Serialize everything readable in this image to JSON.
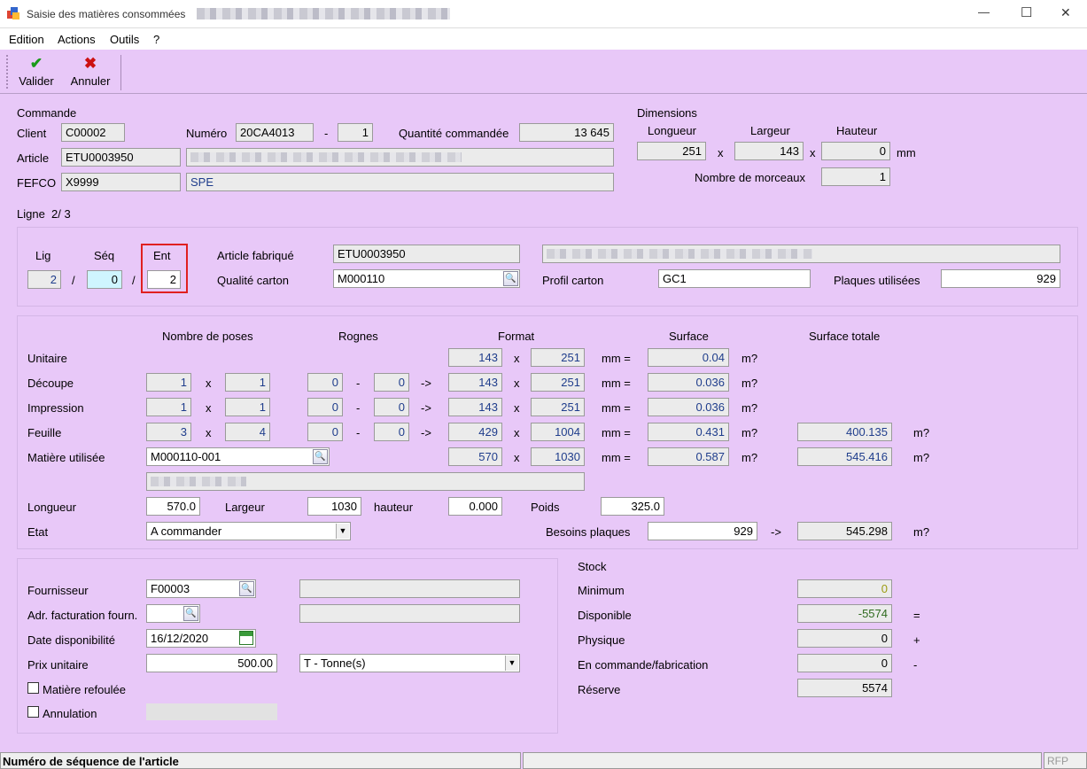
{
  "window": {
    "title": "Saisie des matières consommées",
    "minimize": "—",
    "maximize": "☐",
    "close": "✕"
  },
  "menu": [
    "Edition",
    "Actions",
    "Outils",
    "?"
  ],
  "toolbar": {
    "validate": "Valider",
    "cancel": "Annuler"
  },
  "commande": {
    "header": "Commande",
    "client_label": "Client",
    "client": "C00002",
    "numero_label": "Numéro",
    "numero": "20CA4013",
    "dash": "-",
    "numero_suffix": "1",
    "qte_label": "Quantité commandée",
    "qte": "13 645",
    "article_label": "Article",
    "article": "ETU0003950",
    "fefco_label": "FEFCO",
    "fefco": "X9999",
    "fefco_desc": "SPE"
  },
  "dimensions": {
    "header": "Dimensions",
    "longueur_label": "Longueur",
    "largeur_label": "Largeur",
    "hauteur_label": "Hauteur",
    "longueur": "251",
    "largeur": "143",
    "hauteur": "0",
    "x1": "x",
    "x2": "x",
    "unit": "mm",
    "morceaux_label": "Nombre de morceaux",
    "morceaux": "1"
  },
  "ligne": {
    "label": "Ligne  2/ 3",
    "lig_label": "Lig",
    "seq_label": "Séq",
    "ent_label": "Ent",
    "lig": "2",
    "seq": "0",
    "ent": "2",
    "slash1": "/",
    "slash2": "/",
    "article_fab_label": "Article fabriqué",
    "article_fab": "ETU0003950",
    "qualite_label": "Qualité carton",
    "qualite": "M000110",
    "profil_label": "Profil carton",
    "profil": "GC1",
    "plaques_label": "Plaques utilisées",
    "plaques": "929"
  },
  "grid": {
    "h_poses": "Nombre de poses",
    "h_rognes": "Rognes",
    "h_format": "Format",
    "h_surface": "Surface",
    "h_surface_totale": "Surface totale",
    "x": "x",
    "dash": "-",
    "arrow": "->",
    "mm_eq": "mm =",
    "m2": "m?",
    "rows": [
      {
        "label": "Unitaire",
        "p1": "",
        "p2": "",
        "r1": "",
        "r2": "",
        "f1": "143",
        "f2": "251",
        "s": "0.04",
        "st": ""
      },
      {
        "label": "Découpe",
        "p1": "1",
        "p2": "1",
        "r1": "0",
        "r2": "0",
        "f1": "143",
        "f2": "251",
        "s": "0.036",
        "st": ""
      },
      {
        "label": "Impression",
        "p1": "1",
        "p2": "1",
        "r1": "0",
        "r2": "0",
        "f1": "143",
        "f2": "251",
        "s": "0.036",
        "st": ""
      },
      {
        "label": "Feuille",
        "p1": "3",
        "p2": "4",
        "r1": "0",
        "r2": "0",
        "f1": "429",
        "f2": "1004",
        "s": "0.431",
        "st": "400.135"
      },
      {
        "label": "Matière utilisée",
        "mat": "M000110-001",
        "f1": "570",
        "f2": "1030",
        "s": "0.587",
        "st": "545.416"
      }
    ]
  },
  "dims2": {
    "longueur_label": "Longueur",
    "longueur": "570.0",
    "largeur_label": "Largeur",
    "largeur": "1030",
    "hauteur_label": "hauteur",
    "hauteur": "0.000",
    "poids_label": "Poids",
    "poids": "325.0",
    "etat_label": "Etat",
    "etat": "A commander",
    "besoins_label": "Besoins plaques",
    "besoins": "929",
    "arrow": "->",
    "besoins_total": "545.298",
    "m2": "m?"
  },
  "fourn": {
    "fournisseur_label": "Fournisseur",
    "fournisseur": "F00003",
    "adr_label": "Adr. facturation fourn.",
    "adr": "",
    "date_label": "Date disponibilité",
    "date": "16/12/2020",
    "prix_label": "Prix unitaire",
    "prix": "500.00",
    "unite": "T - Tonne(s)",
    "refoulee_label": "Matière refoulée",
    "annulation_label": "Annulation"
  },
  "stock": {
    "header": "Stock",
    "minimum_label": "Minimum",
    "minimum": "0",
    "disponible_label": "Disponible",
    "disponible": "-5574",
    "disp_op": "=",
    "physique_label": "Physique",
    "physique": "0",
    "phys_op": "+",
    "encommande_label": "En commande/fabrication",
    "encommande": "0",
    "cmd_op": "-",
    "reserve_label": "Réserve",
    "reserve": "5574"
  },
  "statusbar": {
    "text": "Numéro de séquence de l'article",
    "rfp": "RFP"
  },
  "colors": {
    "background": "#E8C8F8",
    "field": "#EBEBEB",
    "highlight_border": "#E02020",
    "value_blue": "#1F3D8C",
    "value_green": "#2E6B1E",
    "value_olive": "#9B9B10"
  }
}
